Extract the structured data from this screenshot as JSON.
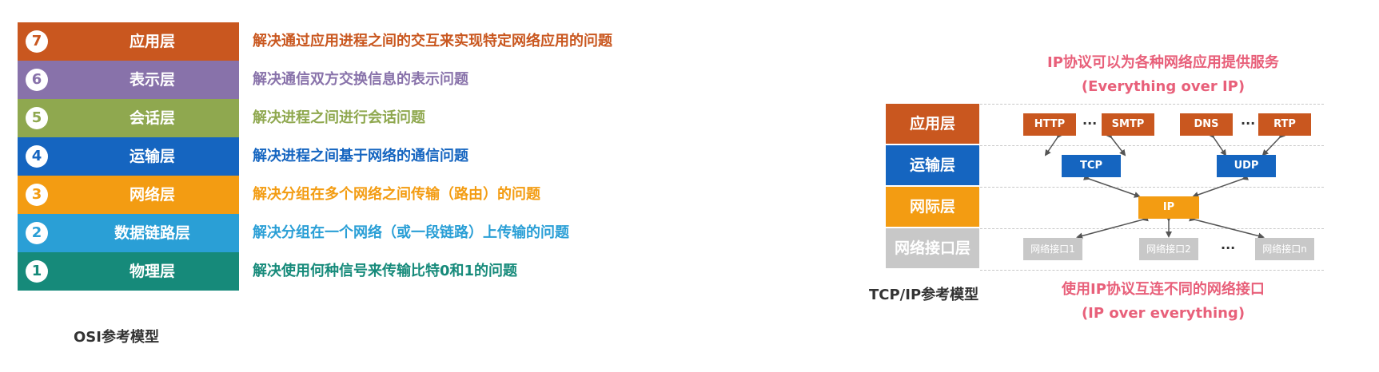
{
  "osi": {
    "caption": "OSI参考模型",
    "layers": [
      {
        "num": "7",
        "name": "应用层",
        "desc": "解决通过应用进程之间的交互来实现特定网络应用的问题",
        "color": "#c9571f"
      },
      {
        "num": "6",
        "name": "表示层",
        "desc": "解决通信双方交换信息的表示问题",
        "color": "#8872aa"
      },
      {
        "num": "5",
        "name": "会话层",
        "desc": "解决进程之间进行会话问题",
        "color": "#8fa84f"
      },
      {
        "num": "4",
        "name": "运输层",
        "desc": "解决进程之间基于网络的通信问题",
        "color": "#1565c0"
      },
      {
        "num": "3",
        "name": "网络层",
        "desc": "解决分组在多个网络之间传输（路由）的问题",
        "color": "#f39c12"
      },
      {
        "num": "2",
        "name": "数据链路层",
        "desc": "解决分组在一个网络（或一段链路）上传输的问题",
        "color": "#2a9fd6"
      },
      {
        "num": "1",
        "name": "物理层",
        "desc": "解决使用何种信号来传输比特0和1的问题",
        "color": "#168a7a"
      }
    ]
  },
  "tcpip": {
    "caption": "TCP/IP参考模型",
    "top_note": {
      "line1": "IP协议可以为各种网络应用提供服务",
      "line2": "(Everything over IP)"
    },
    "bottom_note": {
      "line1": "使用IP协议互连不同的网络接口",
      "line2": "(IP over everything)"
    },
    "layers": [
      {
        "name": "应用层",
        "color": "#c9571f"
      },
      {
        "name": "运输层",
        "color": "#1565c0"
      },
      {
        "name": "网际层",
        "color": "#f39c12"
      },
      {
        "name": "网络接口层",
        "color": "#c8c8c8"
      }
    ],
    "app_protocols": [
      "HTTP",
      "SMTP",
      "DNS",
      "RTP"
    ],
    "transport_protocols": [
      "TCP",
      "UDP"
    ],
    "internet_protocol": "IP",
    "interfaces": [
      "网络接口1",
      "网络接口2",
      "网络接口n"
    ],
    "ellipsis": "···"
  }
}
